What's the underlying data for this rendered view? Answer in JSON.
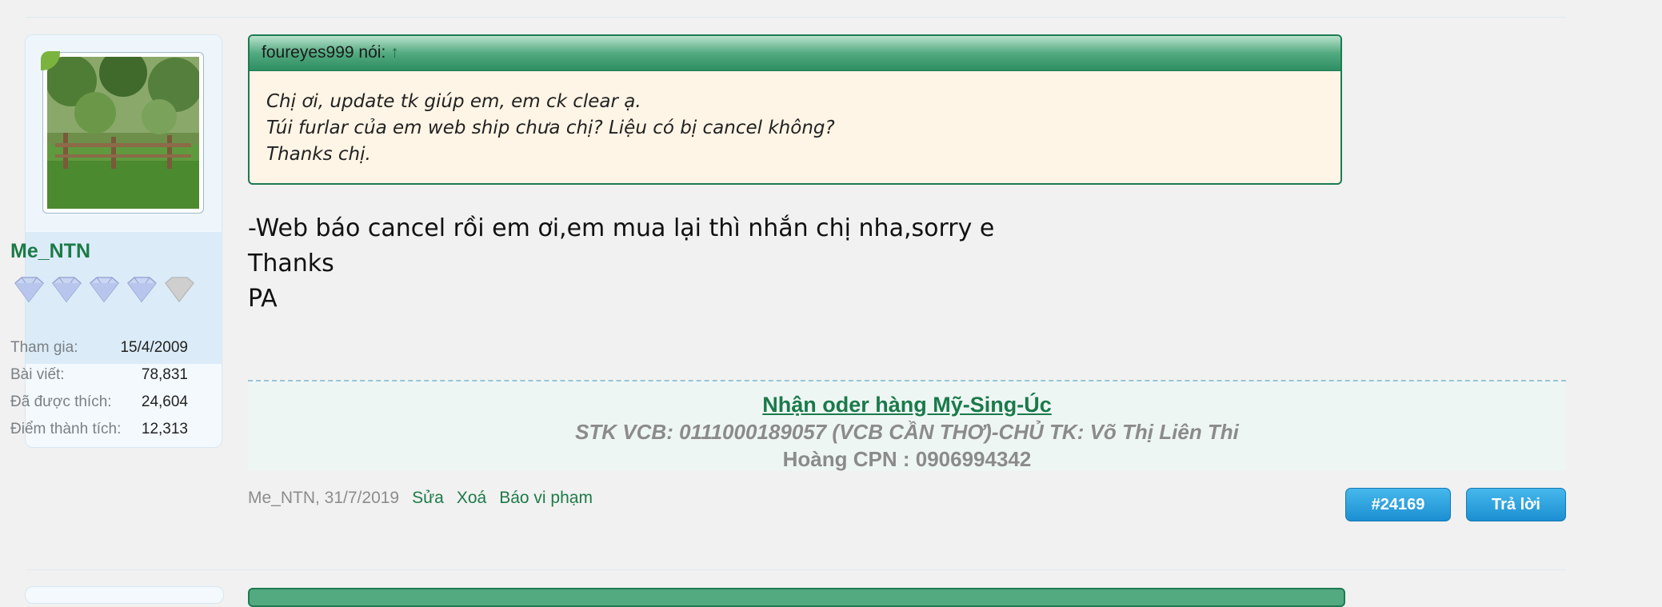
{
  "user": {
    "name": "Me_NTN",
    "rank_stars_filled": 4,
    "rank_stars_total": 5,
    "stats": [
      {
        "label": "Tham gia:",
        "value": "15/4/2009"
      },
      {
        "label": "Bài viết:",
        "value": "78,831"
      },
      {
        "label": "Đã được thích:",
        "value": "24,604"
      },
      {
        "label": "Điểm thành tích:",
        "value": "12,313"
      }
    ]
  },
  "quote": {
    "author_said": "foureyes999 nói:",
    "arrow": "↑",
    "lines": [
      "Chị ơi, update tk giúp em, em ck clear ạ.",
      "Túi furlar của em web ship chưa chị? Liệu có bị cancel không?",
      "Thanks chị."
    ]
  },
  "message": {
    "lines": [
      "-Web báo cancel rồi em ơi,em mua lại thì nhắn chị nha,sorry e",
      "Thanks",
      "PA"
    ]
  },
  "signature": {
    "line1": "Nhận oder hàng Mỹ-Sing-Úc",
    "line2": "STK VCB: 0111000189057 (VCB CẦN THƠ)-CHỦ TK: Võ Thị Liên Thi",
    "line3": "Hoàng CPN : 0906994342"
  },
  "footer": {
    "author_date": "Me_NTN, 31/7/2019",
    "edit": "Sửa",
    "delete": "Xoá",
    "report": "Báo vi phạm",
    "post_number": "#24169",
    "reply": "Trả lời"
  },
  "colors": {
    "accent_green": "#1d7a53",
    "button_blue": "#1b8fd2",
    "quote_bg": "#fff5e6"
  }
}
